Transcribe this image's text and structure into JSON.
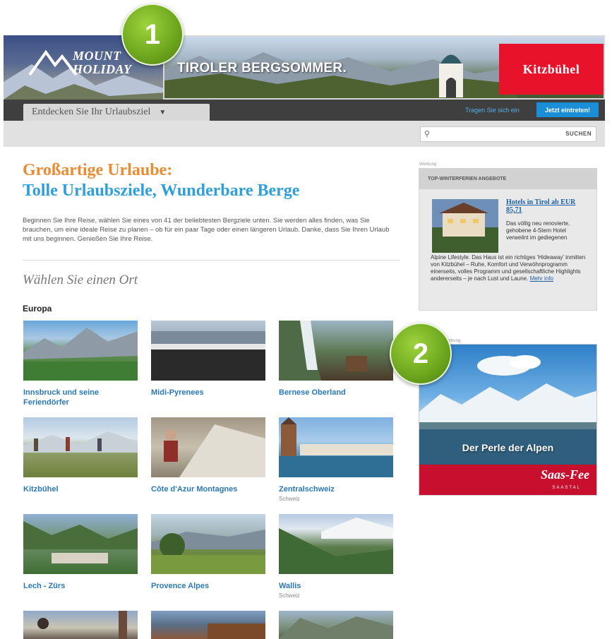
{
  "header": {
    "logo_line1": "MOUNT",
    "logo_line2": "HOLIDAY",
    "banner_text": "TIROLER BERGSOMMER.",
    "banner_brand": "Kitzbühel"
  },
  "callouts": {
    "one": "1",
    "two": "2"
  },
  "nav": {
    "destination_button": "Entdecken Sie Ihr Urlaubsziel",
    "register_link": "Tragen Sie sich ein",
    "join_button": "Jetzt eintreten!"
  },
  "search": {
    "placeholder": "",
    "button": "SUCHEN"
  },
  "main": {
    "headline_line1": "Großartige Urlaube:",
    "headline_line2": "Tolle Urlaubsziele, Wunderbare Berge",
    "intro": "Beginnen Sie Ihre Reise, wählen Sie eines von 41 der beliebtesten Bergziele unten. Sie werden alles finden, was Sie brauchen, um eine ideale Reise zu planen – ob für ein paar Tage oder einen längeren Urlaub. Danke, dass Sie Ihren Urlaub mit uns beginnen. Genießen Sie Ihre Reise.",
    "choose_title": "Wählen Sie einen Ort",
    "region_label": "Europa",
    "destinations": [
      {
        "name": "Innsbruck und seine Feriendörfer",
        "sub": ""
      },
      {
        "name": "Midi-Pyrenees",
        "sub": ""
      },
      {
        "name": "Bernese Oberland",
        "sub": ""
      },
      {
        "name": "Kitzbühel",
        "sub": ""
      },
      {
        "name": "Côte d'Azur Montagnes",
        "sub": ""
      },
      {
        "name": "Zentralschweiz",
        "sub": "Schweiz"
      },
      {
        "name": "Lech - Zürs",
        "sub": ""
      },
      {
        "name": "Provence Alpes",
        "sub": ""
      },
      {
        "name": "Wallis",
        "sub": "Schweiz"
      }
    ]
  },
  "sidebar": {
    "ad_label": "Werbung",
    "offers_title": "TOP-WINTERFERIEN ANGEBOTE",
    "offer_link": "Hotels in Tirol ab EUR 85,71",
    "offer_text": "Das völlig neu renovierte, gehobene 4-Stern Hotel verweilnt im gediegenen",
    "offer_text2": "Alpine Lifestyle. Das Haus ist ein richtiges 'Hideaway' inmitten von Kitzbühel – Ruhe, Komfort und Verwöhnprogramm einerseits, volles Programm und gesellschaftliche Highlights andererseits – je nach Lust und Laune.",
    "offer_more": "Mehr info",
    "ad2_label": "Werbung",
    "ad2_caption": "Der Perle der Alpen",
    "ad2_brand": "Saas-Fee",
    "ad2_sub": "SAASTAL"
  },
  "colors": {
    "nav_dark": "#3f3f3f",
    "headline_orange": "#eb8b32",
    "headline_blue": "#2f9fdb",
    "link_blue": "#2a78b6",
    "callout_green": "#6fa91f",
    "brand_red": "#e8132a"
  }
}
